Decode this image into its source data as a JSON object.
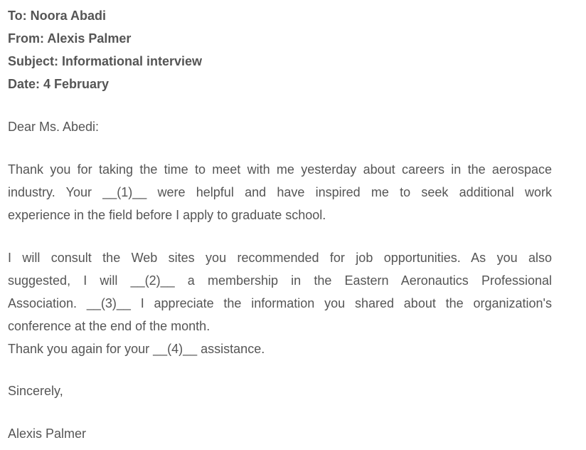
{
  "header": {
    "to": "To: Noora Abadi",
    "from": "From: Alexis Palmer",
    "subject": "Subject: Informational interview",
    "date": "Date: 4 February"
  },
  "salutation": "Dear Ms. Abedi:",
  "paragraph1": {
    "lines": [
      "Thank you for taking the time to meet with me yesterday about careers in the aerospace",
      "industry. Your __(1)__ were helpful and have inspired me to seek additional work",
      "experience in the field before I apply to graduate school."
    ]
  },
  "paragraph2": {
    "lines": [
      "I will consult the Web sites you recommended for job opportunities. As you also",
      "suggested, I will __(2)__ a membership in the Eastern Aeronautics Professional",
      "Association. __(3)__ I appreciate the information you shared about the organization's",
      "conference at the end of the month."
    ]
  },
  "closing_line": "Thank you again for your __(4)__ assistance.",
  "valediction": "Sincerely,",
  "signature": "Alexis Palmer"
}
